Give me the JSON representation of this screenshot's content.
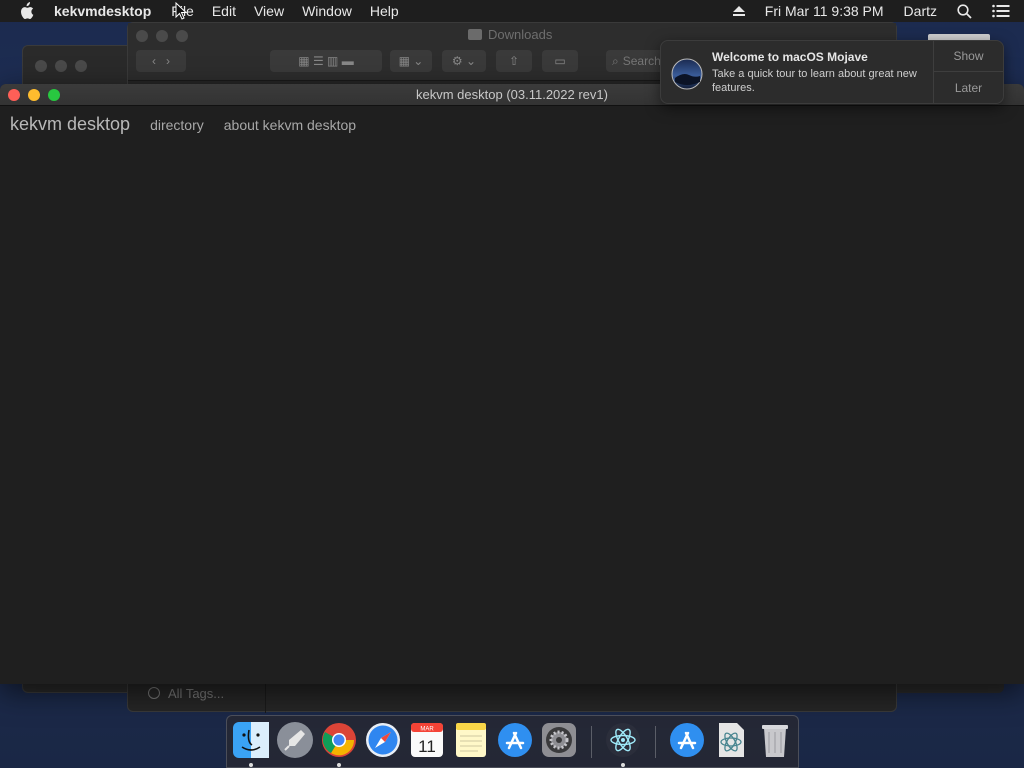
{
  "menubar": {
    "app_name": "kekvmdesktop",
    "menus": [
      "File",
      "Edit",
      "View",
      "Window",
      "Help"
    ],
    "datetime": "Fri Mar 11  9:38 PM",
    "user": "Dartz",
    "icons": [
      "apple-icon",
      "eject-icon",
      "spotlight-search-icon",
      "notification-center-icon"
    ]
  },
  "finder": {
    "title": "Downloads",
    "search_placeholder": "Search",
    "sidebar_tags": "All Tags..."
  },
  "main_window": {
    "title": "kekvm desktop (03.11.2022 rev1)",
    "brand": "kekvm desktop",
    "nav": [
      "directory",
      "about kekvm desktop"
    ]
  },
  "notification": {
    "title": "Welcome to macOS Mojave",
    "body": "Take a quick tour to learn about great new features.",
    "show_label": "Show",
    "later_label": "Later"
  },
  "dock": {
    "calendar_month": "MAR",
    "calendar_day": "11",
    "items": [
      "finder-icon",
      "launchpad-icon",
      "chrome-icon",
      "safari-icon",
      "calendar-icon",
      "notes-icon",
      "app-store-icon",
      "system-preferences-icon",
      "electron-icon",
      "app-store-download-icon",
      "electron-document-icon",
      "trash-icon"
    ]
  }
}
